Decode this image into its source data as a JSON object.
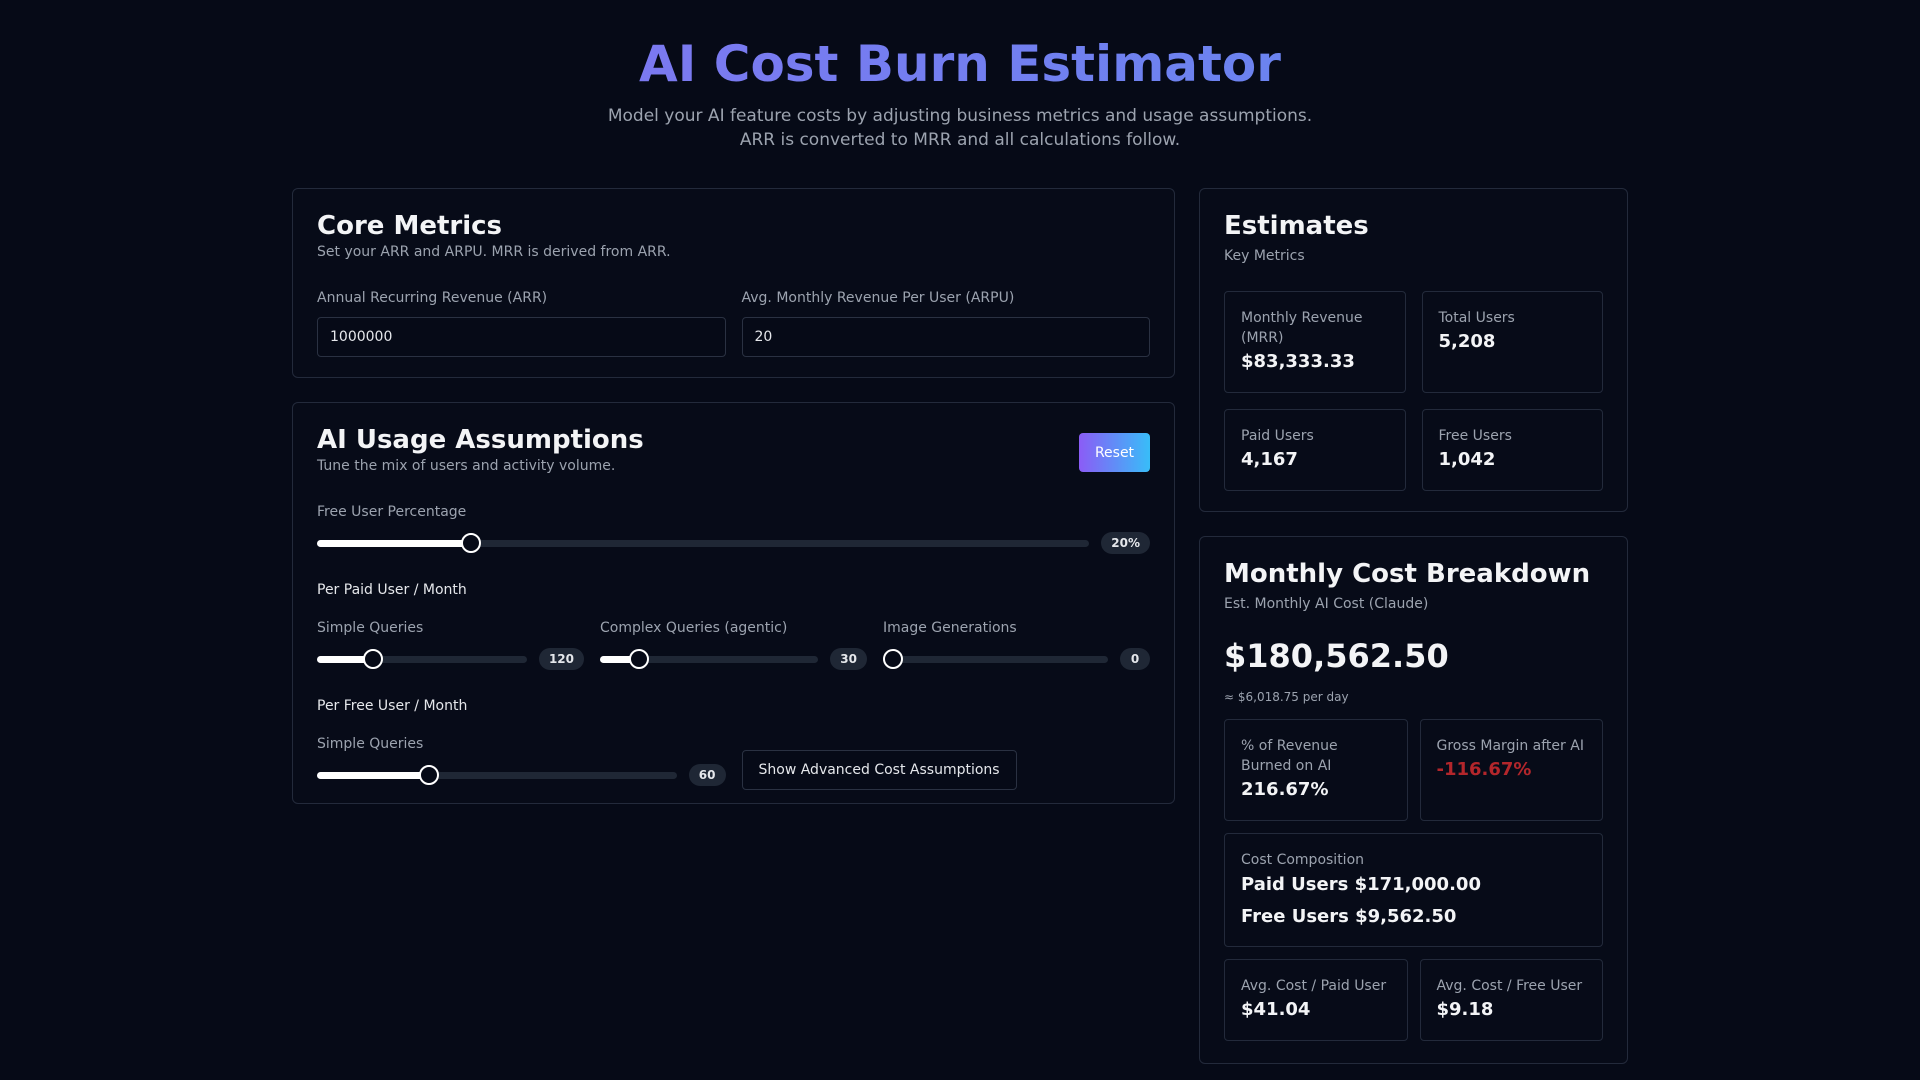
{
  "header": {
    "title": "AI Cost Burn Estimator",
    "subtitle_line1": "Model your AI feature costs by adjusting business metrics and usage assumptions.",
    "subtitle_line2": "ARR is converted to MRR and all calculations follow."
  },
  "core_metrics": {
    "title": "Core Metrics",
    "subtitle": "Set your ARR and ARPU. MRR is derived from ARR.",
    "arr_label": "Annual Recurring Revenue (ARR)",
    "arr_value": "1000000",
    "arpu_label": "Avg. Monthly Revenue Per User (ARPU)",
    "arpu_value": "20"
  },
  "usage": {
    "title": "AI Usage Assumptions",
    "subtitle": "Tune the mix of users and activity volume.",
    "reset_label": "Reset",
    "free_pct": {
      "label": "Free User Percentage",
      "display": "20%",
      "fraction": 0.2
    },
    "paid_section_label": "Per Paid User / Month",
    "paid_sliders": [
      {
        "label": "Simple Queries",
        "display": "120",
        "fraction": 0.265
      },
      {
        "label": "Complex Queries (agentic)",
        "display": "30",
        "fraction": 0.18
      },
      {
        "label": "Image Generations",
        "display": "0",
        "fraction": 0
      }
    ],
    "free_section_label": "Per Free User / Month",
    "free_slider": {
      "label": "Simple Queries",
      "display": "60",
      "fraction": 0.31
    },
    "advanced_button": "Show Advanced Cost Assumptions"
  },
  "estimates": {
    "title": "Estimates",
    "subtitle": "Key Metrics",
    "mrr_label": "Monthly Revenue (MRR)",
    "mrr_value": "$83,333.33",
    "total_users_label": "Total Users",
    "total_users_value": "5,208",
    "paid_users_label": "Paid Users",
    "paid_users_value": "4,167",
    "free_users_label": "Free Users",
    "free_users_value": "1,042"
  },
  "breakdown": {
    "title": "Monthly Cost Breakdown",
    "subtitle": "Est. Monthly AI Cost (Claude)",
    "total": "$180,562.50",
    "per_day": "≈ $6,018.75 per day",
    "pct_label": "% of Revenue Burned on AI",
    "pct_value": "216.67%",
    "margin_label": "Gross Margin after AI",
    "margin_value": "-116.67%",
    "margin_color": "#b3262b",
    "composition_label": "Cost Composition",
    "composition_paid": "Paid Users $171,000.00",
    "composition_free": "Free Users $9,562.50",
    "avg_paid_label": "Avg. Cost / Paid User",
    "avg_paid_value": "$41.04",
    "avg_free_label": "Avg. Cost / Free User",
    "avg_free_value": "$9.18"
  }
}
